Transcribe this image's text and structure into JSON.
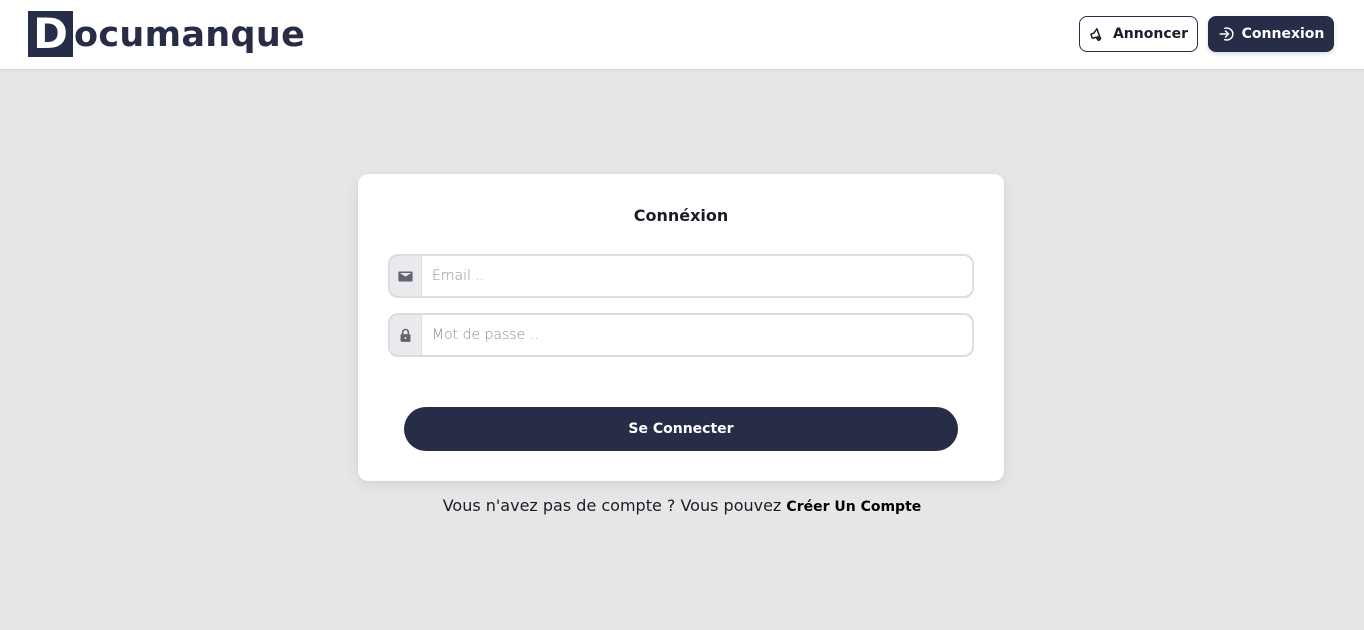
{
  "header": {
    "logo_initial": "D",
    "logo_rest": "ocumanque",
    "announce_label": "Annoncer",
    "announce_icon": "megaphone-icon",
    "login_label": "Connexion",
    "login_icon": "sign-in-icon"
  },
  "login_card": {
    "title": "Connéxion",
    "email": {
      "placeholder": "Email ..",
      "value": "",
      "icon": "envelope-icon"
    },
    "password": {
      "placeholder": "Mot de passe ..",
      "value": "",
      "icon": "lock-icon"
    },
    "submit_label": "Se Connecter"
  },
  "signup": {
    "prompt": "Vous n'avez pas de compte ? Vous pouvez",
    "link_label": "Créer Un Compte"
  },
  "colors": {
    "brand": "#272c47",
    "background": "#e7e7e7",
    "card": "#ffffff"
  }
}
